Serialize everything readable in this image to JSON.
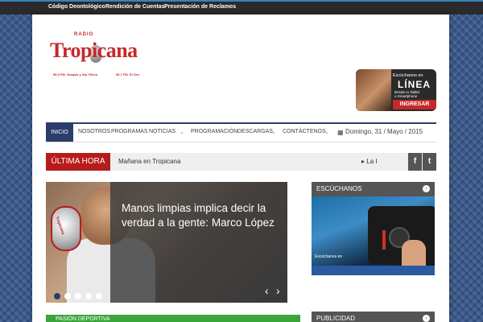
{
  "top_links": [
    "Código Deontológico",
    "Rendición de Cuentas",
    "Presentación de Reclamos"
  ],
  "logo": {
    "radio": "RADIO",
    "name": "Tropicana",
    "left_freq": "96.5 FM. Guayas y Sta. Elena",
    "right_freq": "96.7 FM. El Oro"
  },
  "ad": {
    "line1": "Escúchanos en",
    "line2": "LÍNEA",
    "line3": "Desde tu Tablet",
    "line4": "o Smartphone",
    "button": "INGRESAR"
  },
  "nav": {
    "home": "INICIO",
    "items": [
      "NOSOTROS",
      "PROGRAMAS",
      "NOTICIAS",
      "PROGRAMACIÓN",
      "DESCARGAS",
      "CONTÁCTENOS"
    ],
    "caret": "⌄",
    "date": "Domingo, 31 / Mayo / 2015"
  },
  "ticker": {
    "label": "ÚLTIMA HORA",
    "item": "Mañana en Tropicana",
    "item2": "La I",
    "facebook": "f",
    "twitter": "t"
  },
  "slider": {
    "caption": "Manos limpias implica decir la verdad a la gente: Marco López",
    "mic_label": "Tropicana",
    "prev": "‹",
    "next": "›"
  },
  "sport": {
    "label": "PASIÓN DEPORTIVA"
  },
  "widgets": [
    {
      "title": "ESCÚCHANOS",
      "caption": "Escúchanos en"
    },
    {
      "title": "PUBLICIDAD"
    }
  ],
  "colors": {
    "accent": "#2b3d6b",
    "breaking": "#b71c1c",
    "logo_red": "#c62828",
    "sport_green": "#3aa53a"
  }
}
